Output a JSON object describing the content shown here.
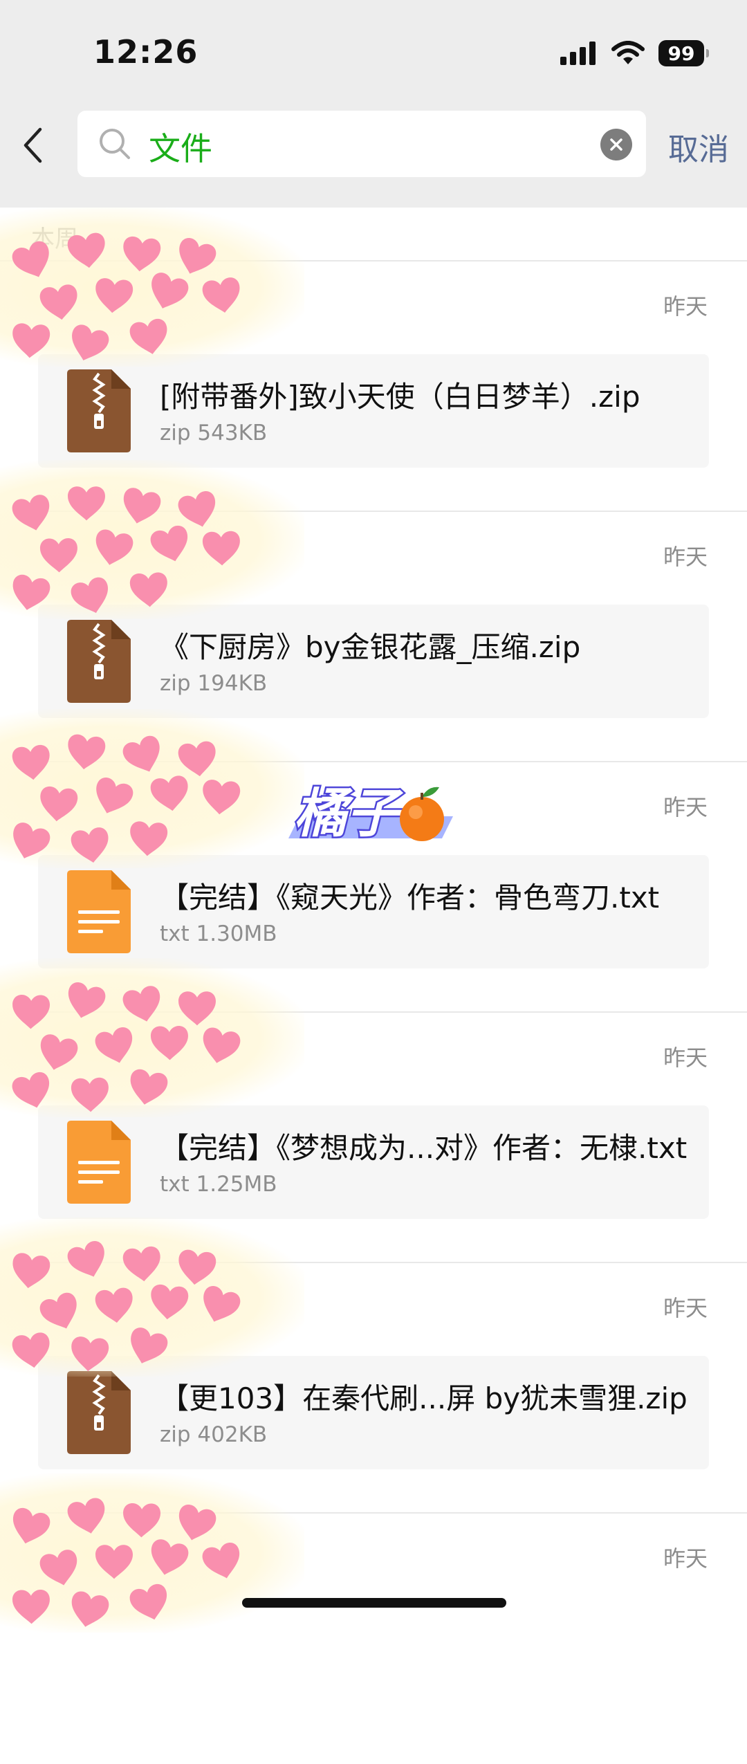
{
  "status_bar": {
    "time": "12:26",
    "battery": "99"
  },
  "search": {
    "value": "文件",
    "cancel_label": "取消"
  },
  "section": {
    "label": "本周"
  },
  "files": [
    {
      "date": "昨天",
      "name": "[附带番外]致小天使（白日梦羊）.zip",
      "meta": "zip 543KB",
      "type": "zip"
    },
    {
      "date": "昨天",
      "name": "《下厨房》by金银花露_压缩.zip",
      "meta": "zip 194KB",
      "type": "zip"
    },
    {
      "date": "昨天",
      "name": "【完结】《窥天光》作者：骨色弯刀.txt",
      "meta": "txt 1.30MB",
      "type": "txt"
    },
    {
      "date": "昨天",
      "name": "【完结】《梦想成为...对》作者：无棣.txt",
      "meta": "txt 1.25MB",
      "type": "txt"
    },
    {
      "date": "昨天",
      "name": "【更103】在秦代刷...屏 by犹未雪狸.zip",
      "meta": "zip 402KB",
      "type": "zip"
    },
    {
      "date": "昨天"
    }
  ],
  "sticker": {
    "text": "橘子",
    "icon": "orange-emoji"
  },
  "colors": {
    "search_text": "#1aad19",
    "cancel": "#576b95",
    "zip_icon": "#8a5530",
    "txt_icon": "#f99c35",
    "heart": "#f98fae"
  }
}
